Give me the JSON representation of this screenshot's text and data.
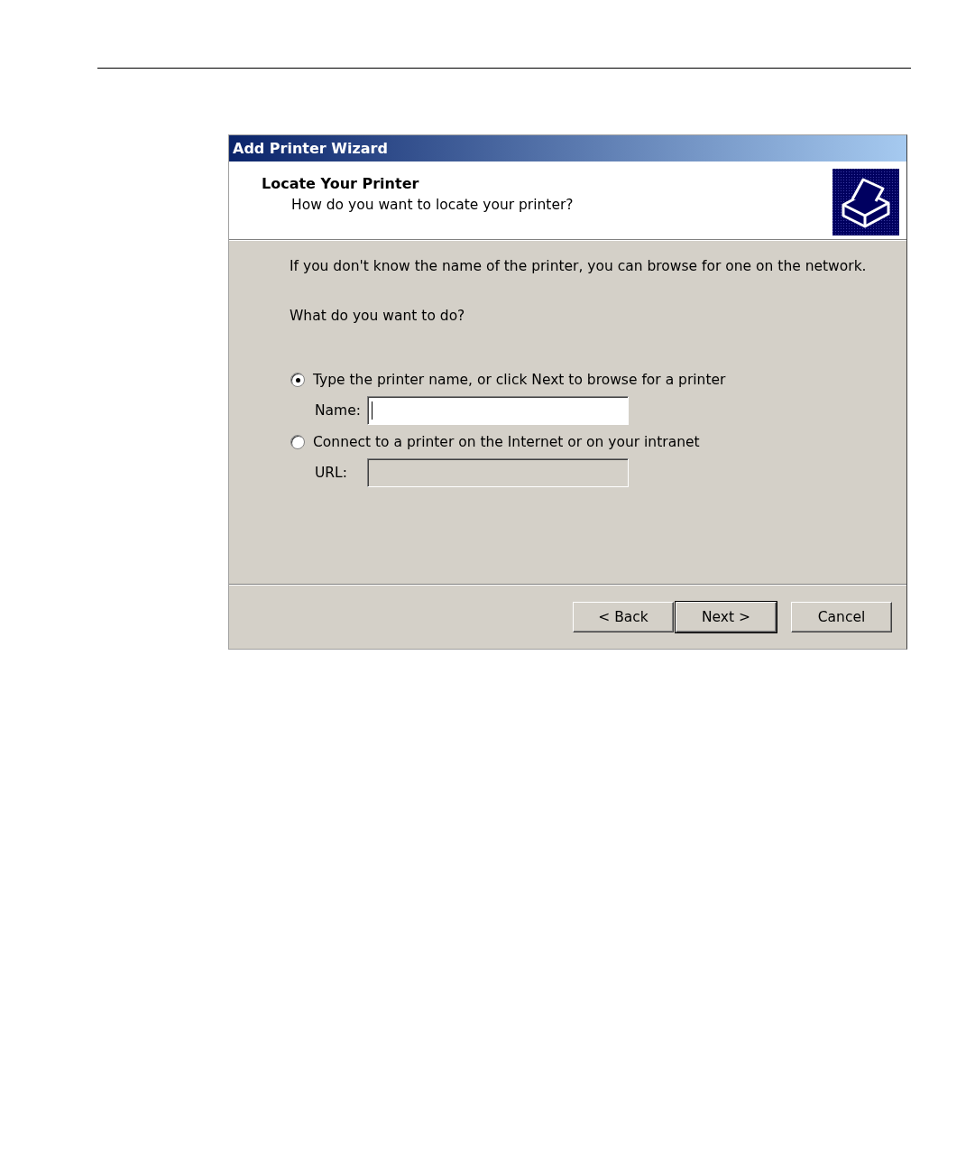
{
  "window": {
    "title": "Add Printer Wizard"
  },
  "header": {
    "title": "Locate Your Printer",
    "subtitle": "How do you want to locate your printer?"
  },
  "body": {
    "intro": "If you don't know the name of the printer, you can browse for one on the network.",
    "question": "What do you want to do?"
  },
  "options": [
    {
      "label": "Type the printer name, or click Next to browse for a printer",
      "selected": true,
      "field": {
        "label": "Name:",
        "disabled": false,
        "focused": true
      }
    },
    {
      "label": "Connect to a printer on the Internet or on your intranet",
      "selected": false,
      "field": {
        "label": "URL:",
        "disabled": true,
        "focused": false
      }
    }
  ],
  "buttons": [
    {
      "label": "< Back",
      "default": false
    },
    {
      "label": "Next >",
      "default": true
    },
    {
      "label": "Cancel",
      "default": false
    }
  ]
}
